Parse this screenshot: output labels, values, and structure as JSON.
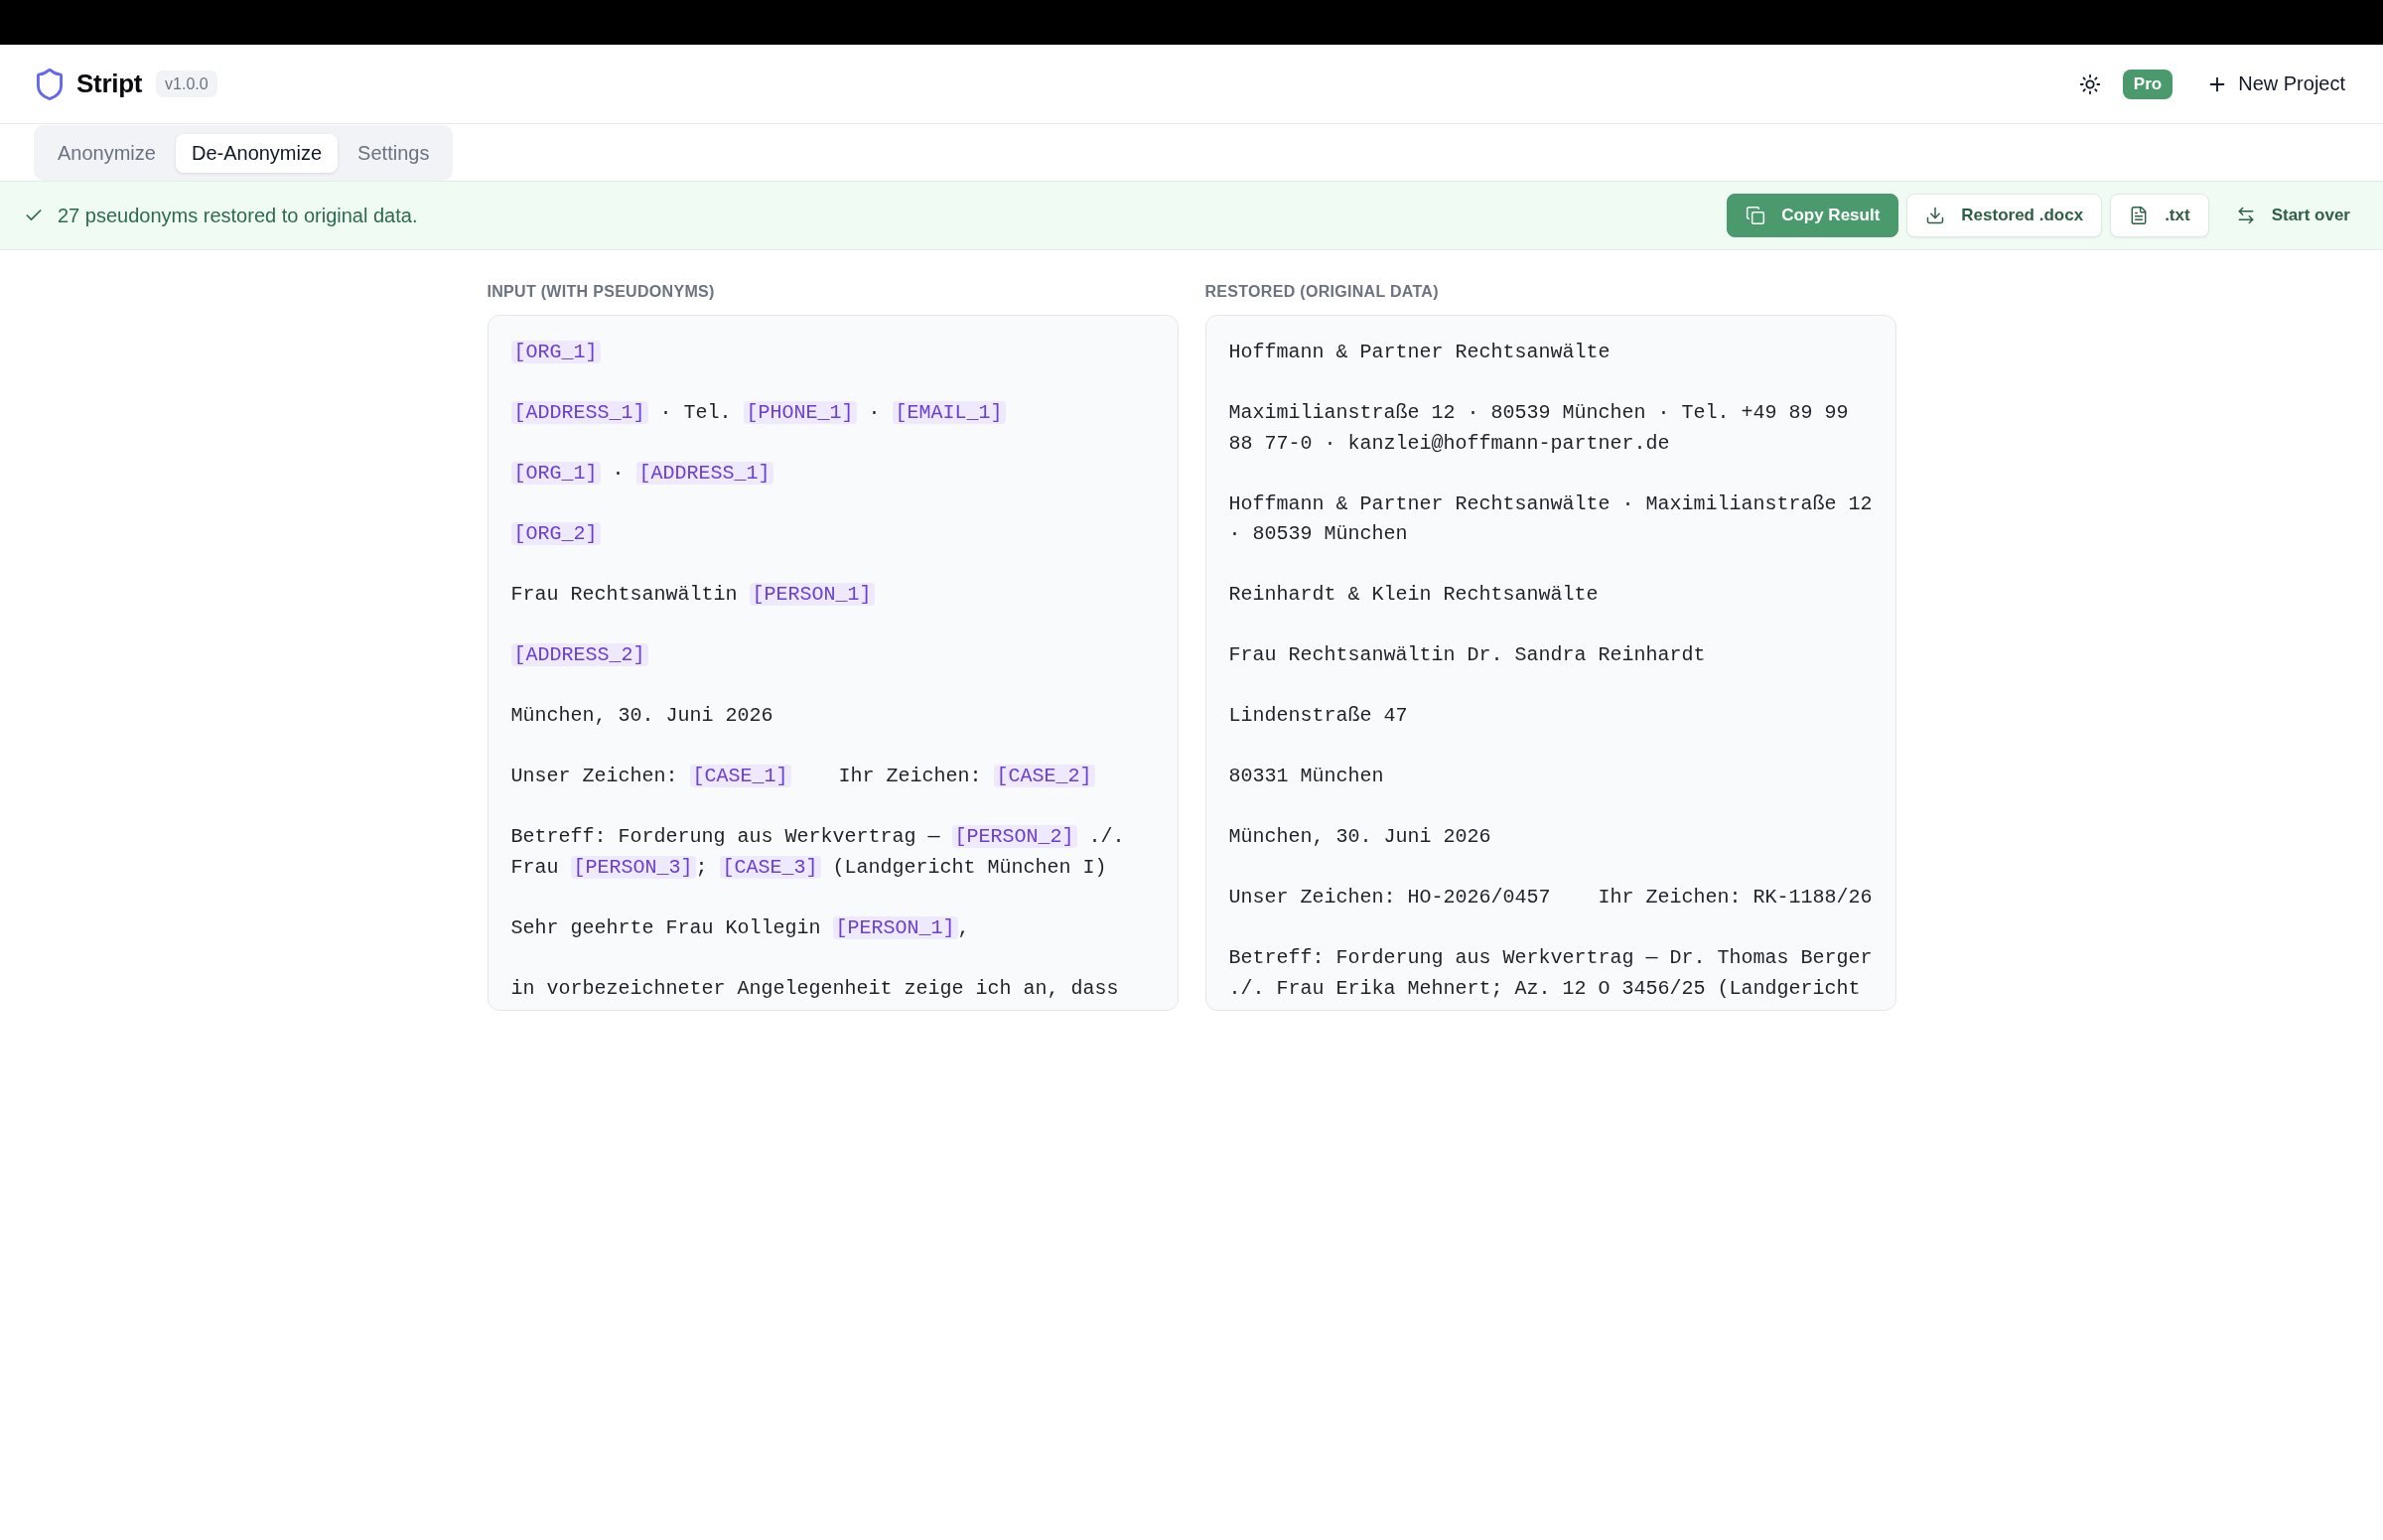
{
  "header": {
    "app_name": "Stript",
    "version": "v1.0.0",
    "plan_badge": "Pro",
    "new_project_button": "New Project"
  },
  "tabs": [
    {
      "label": "Anonymize",
      "selected": false
    },
    {
      "label": "De-Anonymize",
      "selected": true
    },
    {
      "label": "Settings",
      "selected": false
    }
  ],
  "status_bar": {
    "message": "27 pseudonyms restored to original data.",
    "actions": [
      {
        "label": "Copy Result",
        "kind": "primary"
      },
      {
        "label": "Restored .docx",
        "kind": "outline"
      },
      {
        "label": ".txt",
        "kind": "outline"
      },
      {
        "label": "Start over",
        "kind": "ghost"
      }
    ]
  },
  "panels": [
    {
      "label": "INPUT (WITH PSEUDONYMS)",
      "paragraphs": [
        [
          {
            "kind": "token",
            "text": "[ORG_1]"
          }
        ],
        [
          {
            "kind": "token",
            "text": "[ADDRESS_1]"
          },
          {
            "kind": "text",
            "text": " · Tel. "
          },
          {
            "kind": "token",
            "text": "[PHONE_1]"
          },
          {
            "kind": "text",
            "text": " · "
          },
          {
            "kind": "token",
            "text": "[EMAIL_1]"
          }
        ],
        [
          {
            "kind": "token",
            "text": "[ORG_1]"
          },
          {
            "kind": "text",
            "text": " · "
          },
          {
            "kind": "token",
            "text": "[ADDRESS_1]"
          }
        ],
        [
          {
            "kind": "token",
            "text": "[ORG_2]"
          }
        ],
        [
          {
            "kind": "text",
            "text": "Frau Rechtsanwältin "
          },
          {
            "kind": "token",
            "text": "[PERSON_1]"
          }
        ],
        [
          {
            "kind": "token",
            "text": "[ADDRESS_2]"
          }
        ],
        [
          {
            "kind": "text",
            "text": "München, 30. Juni 2026"
          }
        ],
        [
          {
            "kind": "text",
            "text": "Unser Zeichen: "
          },
          {
            "kind": "token",
            "text": "[CASE_1]"
          },
          {
            "kind": "text",
            "text": "    Ihr Zeichen: "
          },
          {
            "kind": "token",
            "text": "[CASE_2]"
          }
        ],
        [
          {
            "kind": "text",
            "text": "Betreff: Forderung aus Werkvertrag — "
          },
          {
            "kind": "token",
            "text": "[PERSON_2]"
          },
          {
            "kind": "text",
            "text": " ./. Frau "
          },
          {
            "kind": "token",
            "text": "[PERSON_3]"
          },
          {
            "kind": "text",
            "text": "; "
          },
          {
            "kind": "token",
            "text": "[CASE_3]"
          },
          {
            "kind": "text",
            "text": " (Landgericht München I)"
          }
        ],
        [
          {
            "kind": "text",
            "text": "Sehr geehrte Frau Kollegin "
          },
          {
            "kind": "token",
            "text": "[PERSON_1]"
          },
          {
            "kind": "text",
            "text": ","
          }
        ],
        [
          {
            "kind": "text",
            "text": "in vorbezeichneter Angelegenheit zeige ich an, dass"
          }
        ]
      ]
    },
    {
      "label": "RESTORED (ORIGINAL DATA)",
      "paragraphs": [
        [
          {
            "kind": "text",
            "text": "Hoffmann & Partner Rechtsanwälte"
          }
        ],
        [
          {
            "kind": "text",
            "text": "Maximilianstraße 12 · 80539 München · Tel. +49 89 99 88 77-0 · kanzlei@hoffmann-partner.de"
          }
        ],
        [
          {
            "kind": "text",
            "text": "Hoffmann & Partner Rechtsanwälte · Maximilianstraße 12 · 80539 München"
          }
        ],
        [
          {
            "kind": "text",
            "text": "Reinhardt & Klein Rechtsanwälte"
          }
        ],
        [
          {
            "kind": "text",
            "text": "Frau Rechtsanwältin Dr. Sandra Reinhardt"
          }
        ],
        [
          {
            "kind": "text",
            "text": "Lindenstraße 47"
          }
        ],
        [
          {
            "kind": "text",
            "text": "80331 München"
          }
        ],
        [
          {
            "kind": "text",
            "text": "München, 30. Juni 2026"
          }
        ],
        [
          {
            "kind": "text",
            "text": "Unser Zeichen: HO-2026/0457    Ihr Zeichen: RK-1188/26"
          }
        ],
        [
          {
            "kind": "text",
            "text": "Betreff: Forderung aus Werkvertrag — Dr. Thomas Berger ./. Frau Erika Mehnert; Az. 12 O 3456/25 (Landgericht"
          }
        ]
      ]
    }
  ]
}
